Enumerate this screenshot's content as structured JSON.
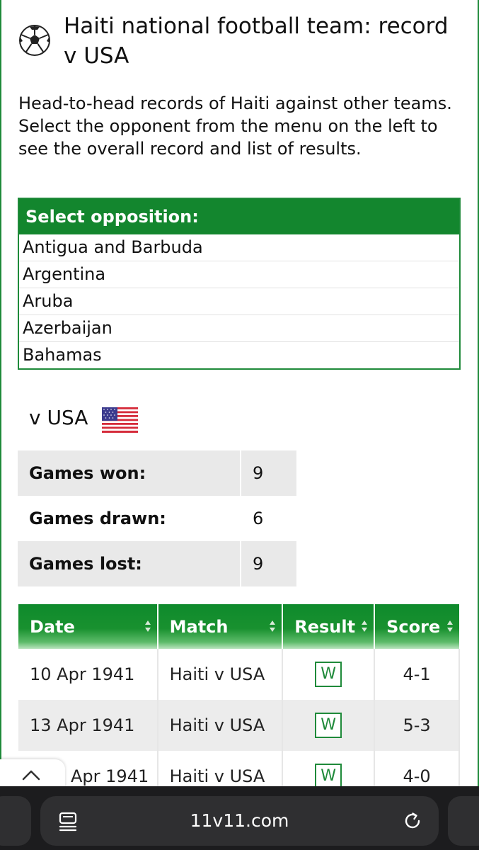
{
  "header": {
    "title": "Haiti national football team: record v USA"
  },
  "intro": "Head-to-head records of Haiti against other teams. Select the opponent from the menu on the left to see the overall record and list of results.",
  "opposition_menu": {
    "header": "Select opposition:",
    "items": [
      "Antigua and Barbuda",
      "Argentina",
      "Aruba",
      "Azerbaijan",
      "Bahamas"
    ]
  },
  "opponent": {
    "label": "v USA",
    "flag": "usa-flag-icon"
  },
  "stats": [
    {
      "label": "Games won:",
      "value": "9"
    },
    {
      "label": "Games drawn:",
      "value": "6"
    },
    {
      "label": "Games lost:",
      "value": "9"
    }
  ],
  "results_table": {
    "headers": [
      "Date",
      "Match",
      "Result",
      "Score"
    ],
    "rows": [
      {
        "date": "10 Apr 1941",
        "match": "Haiti v USA",
        "result": "W",
        "score": "4-1"
      },
      {
        "date": "13 Apr 1941",
        "match": "Haiti v USA",
        "result": "W",
        "score": "5-3"
      },
      {
        "date": "Apr 1941",
        "match": "Haiti v USA",
        "result": "W",
        "score": "4-0"
      }
    ]
  },
  "browser": {
    "url": "11v11.com"
  },
  "colors": {
    "brand_green": "#13862e",
    "badge_green": "#1f8a3a",
    "browser_bg": "#1c1c1e"
  }
}
